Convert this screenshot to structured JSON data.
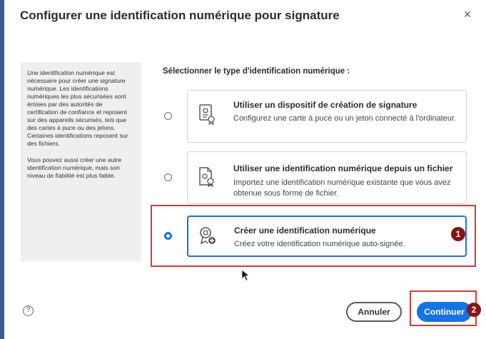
{
  "dialog": {
    "title": "Configurer une identification numérique pour signature",
    "close_glyph": "×"
  },
  "info": {
    "paragraph1": "Une identification numérique est nécessaire pour créer une signature numérique. Les identifications numériques les plus sécurisées sont émises par des autorités de certification de confiance et reposent sur des appareils sécurisés, tels que des cartes à puce ou des jetons. Certaines identifications reposent sur des fichiers.",
    "paragraph2": "Vous pouvez aussi créer une autre identification numérique, mais son niveau de fiabilité est plus faible."
  },
  "selection": {
    "label": "Sélectionner le type d'identification numérique :",
    "selected_index": 2,
    "options": [
      {
        "title": "Utiliser un dispositif de création de signature",
        "description": "Configurez une carte à puce ou un jeton connecté à l'ordinateur.",
        "icon": "smartcard-certificate-icon"
      },
      {
        "title": "Utiliser une identification numérique depuis un fichier",
        "description": "Importez une identification numérique existante que vous avez obtenue sous forme de fichier.",
        "icon": "file-certificate-icon"
      },
      {
        "title": "Créer une identification numérique",
        "description": "Créez votre identification numérique auto-signée.",
        "icon": "create-certificate-icon"
      }
    ]
  },
  "annotations": {
    "badge1": "1",
    "badge2": "2",
    "highlight_color": "#d23a3a",
    "badge_color": "#8a1414"
  },
  "footer": {
    "help_glyph": "?",
    "cancel_label": "Annuler",
    "continue_label": "Continuer"
  },
  "colors": {
    "accent": "#1473e6",
    "backdrop": "#3a5a94"
  }
}
